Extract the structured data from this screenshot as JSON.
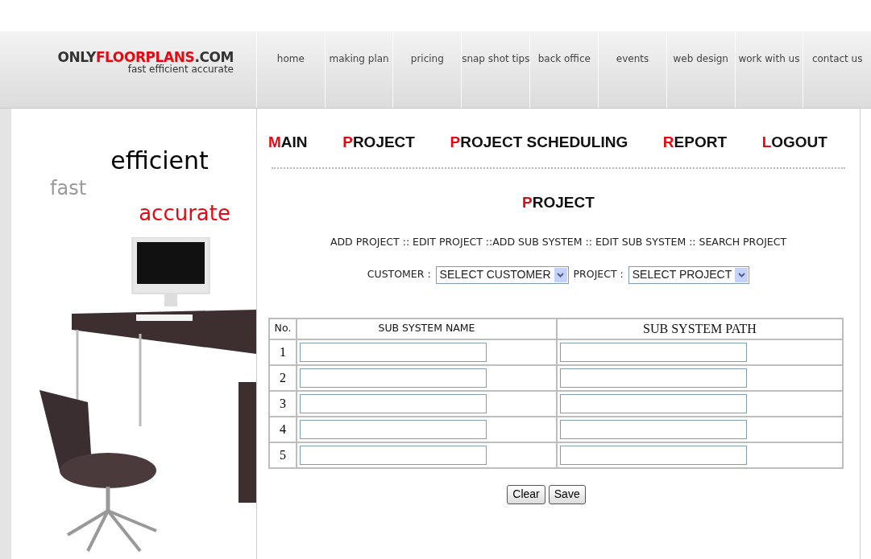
{
  "logo": {
    "parts": [
      {
        "text": "ONLY",
        "accent": false
      },
      {
        "text": "FLOORPLANS",
        "accent": true
      },
      {
        "text": ".COM",
        "accent": false
      }
    ],
    "tagline": "fast efficient accurate"
  },
  "top_nav": [
    "home",
    "making plan",
    "pricing",
    "snap shot tips",
    "back office",
    "events",
    "web design",
    "work with us",
    "contact us"
  ],
  "banner": {
    "words": [
      {
        "text": "efficient",
        "kind": "dark"
      },
      {
        "text": "fast",
        "kind": "light"
      },
      {
        "text": "accurate",
        "kind": "accent"
      }
    ]
  },
  "main_menu": [
    "MAIN",
    "PROJECT",
    "PROJECT SCHEDULING",
    "REPORT",
    "LOGOUT"
  ],
  "page_title": "PROJECT",
  "sub_links": "ADD PROJECT :: EDIT PROJECT ::ADD SUB SYSTEM :: EDIT SUB SYSTEM :: SEARCH PROJECT",
  "filters": [
    {
      "label": "CUSTOMER :",
      "value": "SELECT CUSTOMER"
    },
    {
      "label": "PROJECT :",
      "value": "SELECT PROJECT"
    }
  ],
  "table": {
    "columns": [
      "No.",
      "SUB SYSTEM NAME",
      "SUB SYSTEM PATH"
    ],
    "rows": [
      {
        "no": "1"
      },
      {
        "no": "2"
      },
      {
        "no": "3"
      },
      {
        "no": "4"
      },
      {
        "no": "5"
      }
    ]
  },
  "buttons": [
    "Clear",
    "Save"
  ]
}
